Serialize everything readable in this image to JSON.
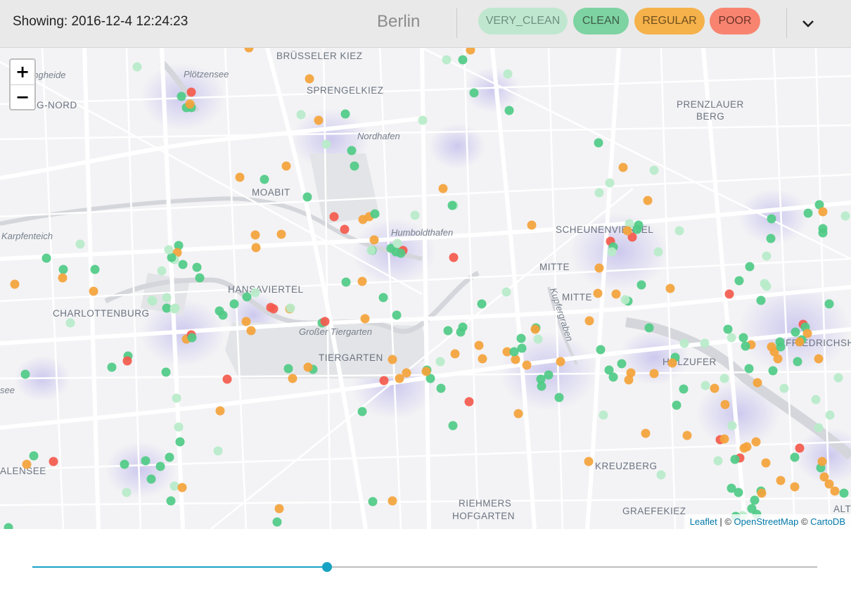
{
  "header": {
    "showing_label": "Showing: 2016-12-4 12:24:23",
    "city": "Berlin",
    "filters": [
      {
        "label": "VERY_CLEAN",
        "bg": "#bfe7cf",
        "fg": "#6f8f7e"
      },
      {
        "label": "CLEAN",
        "bg": "#7dd3a1",
        "fg": "#3d5d4a"
      },
      {
        "label": "REGULAR",
        "bg": "#f5b14a",
        "fg": "#6e4e1e"
      },
      {
        "label": "POOR",
        "bg": "#f88470",
        "fg": "#6e3228"
      }
    ],
    "dropdown_icon": "chevron-down-icon"
  },
  "map": {
    "zoom_in_label": "+",
    "zoom_out_label": "−",
    "labels": [
      {
        "text": "BRÜSSELER KIEZ",
        "style": "caps"
      },
      {
        "text": "Plötzensee",
        "style": "italic"
      },
      {
        "text": "SPRENGELKIEZ",
        "style": "caps"
      },
      {
        "text": "Nordhafen",
        "style": "italic"
      },
      {
        "text": "PRENZLAUER",
        "style": "caps"
      },
      {
        "text": "BERG",
        "style": "caps"
      },
      {
        "text": "MOABIT",
        "style": "caps"
      },
      {
        "text": "Humboldthafen",
        "style": "italic"
      },
      {
        "text": "SCHEUNENVIERTEL",
        "style": "caps"
      },
      {
        "text": "Karpfenteich",
        "style": "italic"
      },
      {
        "text": "MITTE",
        "style": "caps"
      },
      {
        "text": "MITTE",
        "style": "caps"
      },
      {
        "text": "HANSAVIERTEL",
        "style": "caps"
      },
      {
        "text": "CHARLOTTENBURG",
        "style": "caps"
      },
      {
        "text": "Großer Tiergarten",
        "style": "italic"
      },
      {
        "text": "TIERGARTEN",
        "style": "caps"
      },
      {
        "text": "HOLZUFER",
        "style": "caps"
      },
      {
        "text": "FRIEDRICHSH",
        "style": "caps"
      },
      {
        "text": "KREUZBERG",
        "style": "caps"
      },
      {
        "text": "RIEHMERS",
        "style": "caps"
      },
      {
        "text": "HOFGARTEN",
        "style": "caps"
      },
      {
        "text": "GRAEFEKIEZ",
        "style": "caps"
      },
      {
        "text": "ALENSEE",
        "style": "caps"
      },
      {
        "text": "BURG-NORD",
        "style": "caps"
      },
      {
        "text": "ungheide",
        "style": "italic"
      },
      {
        "text": "Kupfergraben",
        "style": "italic"
      },
      {
        "text": "see",
        "style": "italic"
      },
      {
        "text": "ALT",
        "style": "caps"
      }
    ],
    "attribution": {
      "leaflet": "Leaflet",
      "sep1": " | © ",
      "osm": "OpenStreetMap",
      "sep2": " © ",
      "carto": "CartoDB"
    }
  },
  "colors": {
    "very_clean": "#b7ecc9",
    "clean": "#4fcb86",
    "regular": "#f4a33a",
    "poor": "#f45a4c"
  },
  "slider": {
    "progress": 0.375
  }
}
